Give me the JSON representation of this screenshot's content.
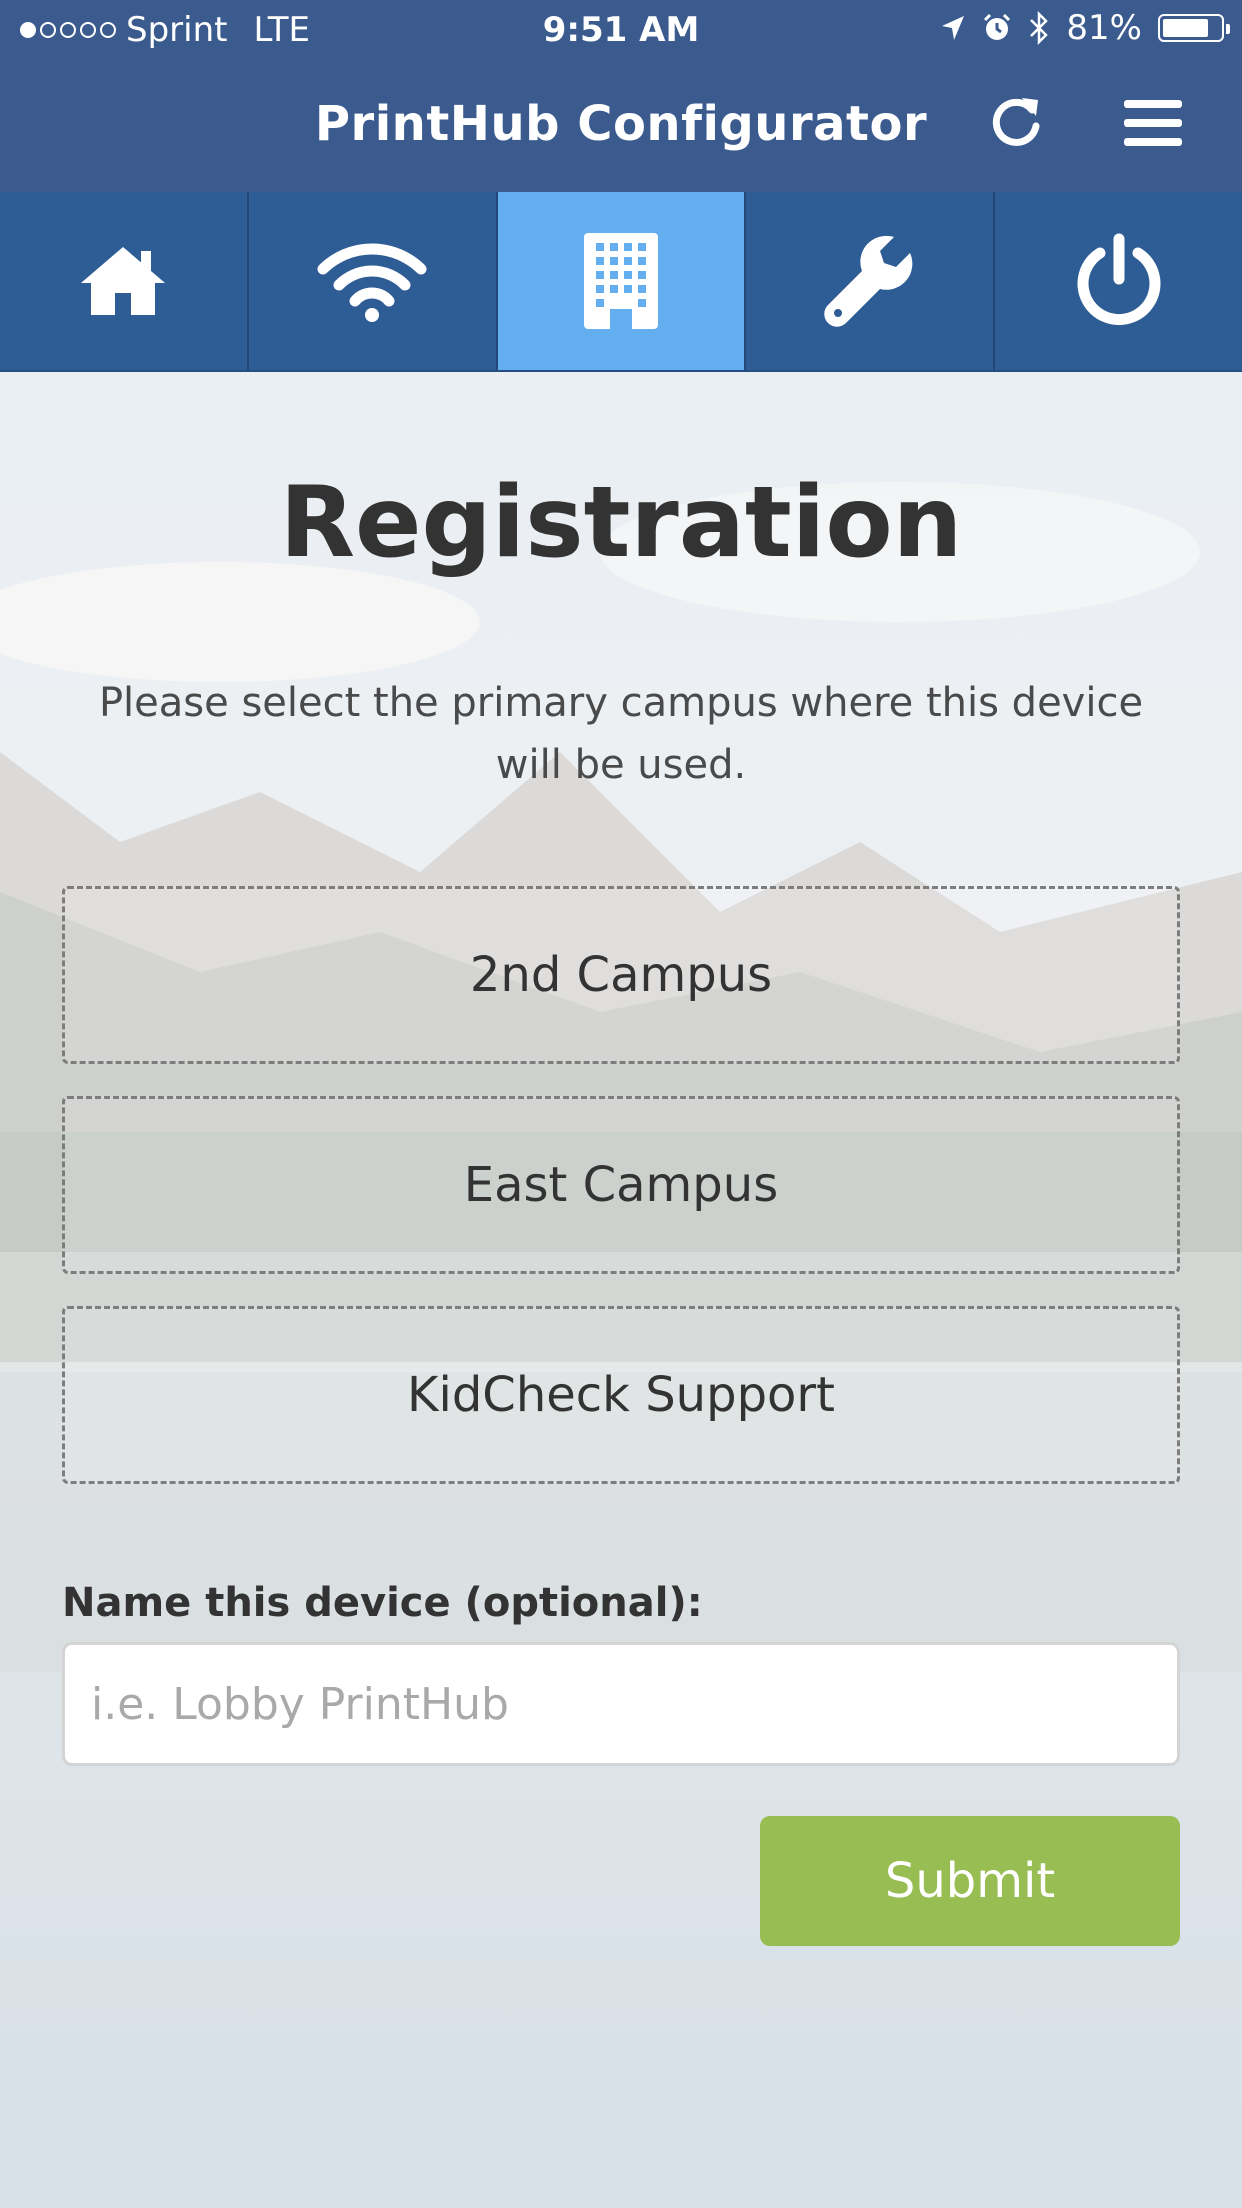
{
  "status_bar": {
    "carrier": "Sprint",
    "network": "LTE",
    "time": "9:51 AM",
    "battery_percent": "81%",
    "battery_level": 0.81,
    "signal_bars_filled": 1,
    "signal_bars_total": 5,
    "icons": [
      "location-arrow-icon",
      "alarm-icon",
      "bluetooth-icon",
      "battery-icon"
    ]
  },
  "header": {
    "title": "PrintHub Configurator",
    "refresh_icon": "refresh-icon",
    "menu_icon": "hamburger-menu-icon"
  },
  "nav": {
    "tabs": [
      {
        "icon": "home-icon",
        "active": false
      },
      {
        "icon": "wifi-icon",
        "active": false
      },
      {
        "icon": "building-icon",
        "active": true
      },
      {
        "icon": "wrench-icon",
        "active": false
      },
      {
        "icon": "power-icon",
        "active": false
      }
    ]
  },
  "main": {
    "title": "Registration",
    "instructions": "Please select the primary campus where this device will be used.",
    "campuses": [
      "2nd Campus",
      "East Campus",
      "KidCheck Support"
    ],
    "device_name": {
      "label": "Name this device (optional):",
      "placeholder": "i.e. Lobby PrintHub",
      "value": ""
    },
    "submit_label": "Submit"
  },
  "colors": {
    "header_bg": "#3b5b8f",
    "tab_bg": "#2e5d96",
    "tab_active_bg": "#62aeef",
    "submit_bg": "#97bd53"
  }
}
